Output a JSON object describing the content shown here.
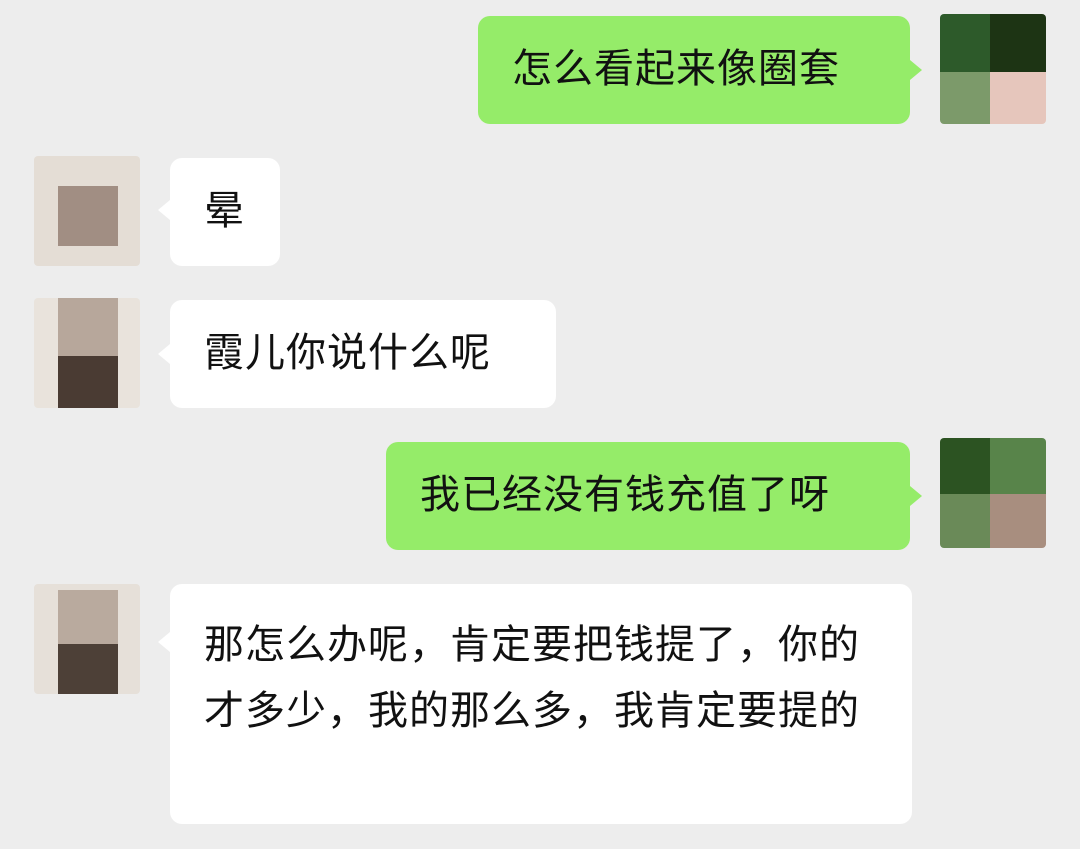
{
  "messages": [
    {
      "direction": "sent",
      "text": "怎么看起来像圈套"
    },
    {
      "direction": "received",
      "text": "晕"
    },
    {
      "direction": "received",
      "text": "霞儿你说什么呢"
    },
    {
      "direction": "sent",
      "text": "我已经没有钱充值了呀"
    },
    {
      "direction": "received",
      "text": "那怎么办呢，肯定要把钱提了，你的才多少，我的那么多，我肯定要提的"
    }
  ],
  "colors": {
    "background": "#ededed",
    "sent_bubble": "#95ec69",
    "received_bubble": "#ffffff",
    "text": "#111111"
  }
}
